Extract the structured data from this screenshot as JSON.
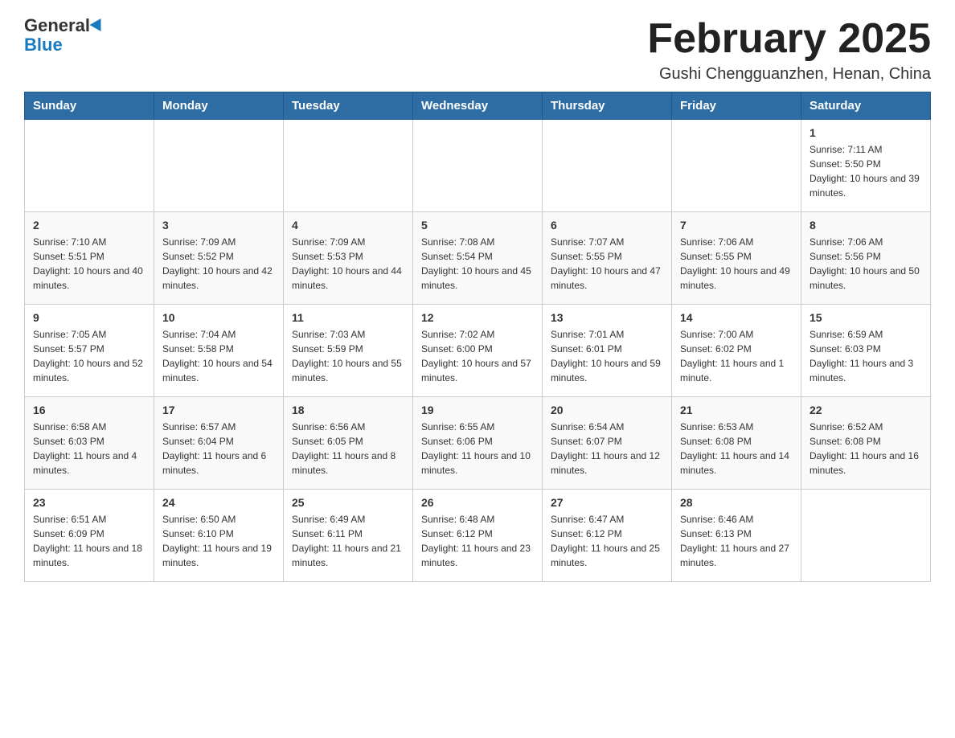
{
  "header": {
    "logo_line1": "General",
    "logo_line2": "Blue",
    "title": "February 2025",
    "location": "Gushi Chengguanzhen, Henan, China"
  },
  "days_of_week": [
    "Sunday",
    "Monday",
    "Tuesday",
    "Wednesday",
    "Thursday",
    "Friday",
    "Saturday"
  ],
  "weeks": [
    [
      {
        "day": "",
        "info": ""
      },
      {
        "day": "",
        "info": ""
      },
      {
        "day": "",
        "info": ""
      },
      {
        "day": "",
        "info": ""
      },
      {
        "day": "",
        "info": ""
      },
      {
        "day": "",
        "info": ""
      },
      {
        "day": "1",
        "info": "Sunrise: 7:11 AM\nSunset: 5:50 PM\nDaylight: 10 hours and 39 minutes."
      }
    ],
    [
      {
        "day": "2",
        "info": "Sunrise: 7:10 AM\nSunset: 5:51 PM\nDaylight: 10 hours and 40 minutes."
      },
      {
        "day": "3",
        "info": "Sunrise: 7:09 AM\nSunset: 5:52 PM\nDaylight: 10 hours and 42 minutes."
      },
      {
        "day": "4",
        "info": "Sunrise: 7:09 AM\nSunset: 5:53 PM\nDaylight: 10 hours and 44 minutes."
      },
      {
        "day": "5",
        "info": "Sunrise: 7:08 AM\nSunset: 5:54 PM\nDaylight: 10 hours and 45 minutes."
      },
      {
        "day": "6",
        "info": "Sunrise: 7:07 AM\nSunset: 5:55 PM\nDaylight: 10 hours and 47 minutes."
      },
      {
        "day": "7",
        "info": "Sunrise: 7:06 AM\nSunset: 5:55 PM\nDaylight: 10 hours and 49 minutes."
      },
      {
        "day": "8",
        "info": "Sunrise: 7:06 AM\nSunset: 5:56 PM\nDaylight: 10 hours and 50 minutes."
      }
    ],
    [
      {
        "day": "9",
        "info": "Sunrise: 7:05 AM\nSunset: 5:57 PM\nDaylight: 10 hours and 52 minutes."
      },
      {
        "day": "10",
        "info": "Sunrise: 7:04 AM\nSunset: 5:58 PM\nDaylight: 10 hours and 54 minutes."
      },
      {
        "day": "11",
        "info": "Sunrise: 7:03 AM\nSunset: 5:59 PM\nDaylight: 10 hours and 55 minutes."
      },
      {
        "day": "12",
        "info": "Sunrise: 7:02 AM\nSunset: 6:00 PM\nDaylight: 10 hours and 57 minutes."
      },
      {
        "day": "13",
        "info": "Sunrise: 7:01 AM\nSunset: 6:01 PM\nDaylight: 10 hours and 59 minutes."
      },
      {
        "day": "14",
        "info": "Sunrise: 7:00 AM\nSunset: 6:02 PM\nDaylight: 11 hours and 1 minute."
      },
      {
        "day": "15",
        "info": "Sunrise: 6:59 AM\nSunset: 6:03 PM\nDaylight: 11 hours and 3 minutes."
      }
    ],
    [
      {
        "day": "16",
        "info": "Sunrise: 6:58 AM\nSunset: 6:03 PM\nDaylight: 11 hours and 4 minutes."
      },
      {
        "day": "17",
        "info": "Sunrise: 6:57 AM\nSunset: 6:04 PM\nDaylight: 11 hours and 6 minutes."
      },
      {
        "day": "18",
        "info": "Sunrise: 6:56 AM\nSunset: 6:05 PM\nDaylight: 11 hours and 8 minutes."
      },
      {
        "day": "19",
        "info": "Sunrise: 6:55 AM\nSunset: 6:06 PM\nDaylight: 11 hours and 10 minutes."
      },
      {
        "day": "20",
        "info": "Sunrise: 6:54 AM\nSunset: 6:07 PM\nDaylight: 11 hours and 12 minutes."
      },
      {
        "day": "21",
        "info": "Sunrise: 6:53 AM\nSunset: 6:08 PM\nDaylight: 11 hours and 14 minutes."
      },
      {
        "day": "22",
        "info": "Sunrise: 6:52 AM\nSunset: 6:08 PM\nDaylight: 11 hours and 16 minutes."
      }
    ],
    [
      {
        "day": "23",
        "info": "Sunrise: 6:51 AM\nSunset: 6:09 PM\nDaylight: 11 hours and 18 minutes."
      },
      {
        "day": "24",
        "info": "Sunrise: 6:50 AM\nSunset: 6:10 PM\nDaylight: 11 hours and 19 minutes."
      },
      {
        "day": "25",
        "info": "Sunrise: 6:49 AM\nSunset: 6:11 PM\nDaylight: 11 hours and 21 minutes."
      },
      {
        "day": "26",
        "info": "Sunrise: 6:48 AM\nSunset: 6:12 PM\nDaylight: 11 hours and 23 minutes."
      },
      {
        "day": "27",
        "info": "Sunrise: 6:47 AM\nSunset: 6:12 PM\nDaylight: 11 hours and 25 minutes."
      },
      {
        "day": "28",
        "info": "Sunrise: 6:46 AM\nSunset: 6:13 PM\nDaylight: 11 hours and 27 minutes."
      },
      {
        "day": "",
        "info": ""
      }
    ]
  ]
}
